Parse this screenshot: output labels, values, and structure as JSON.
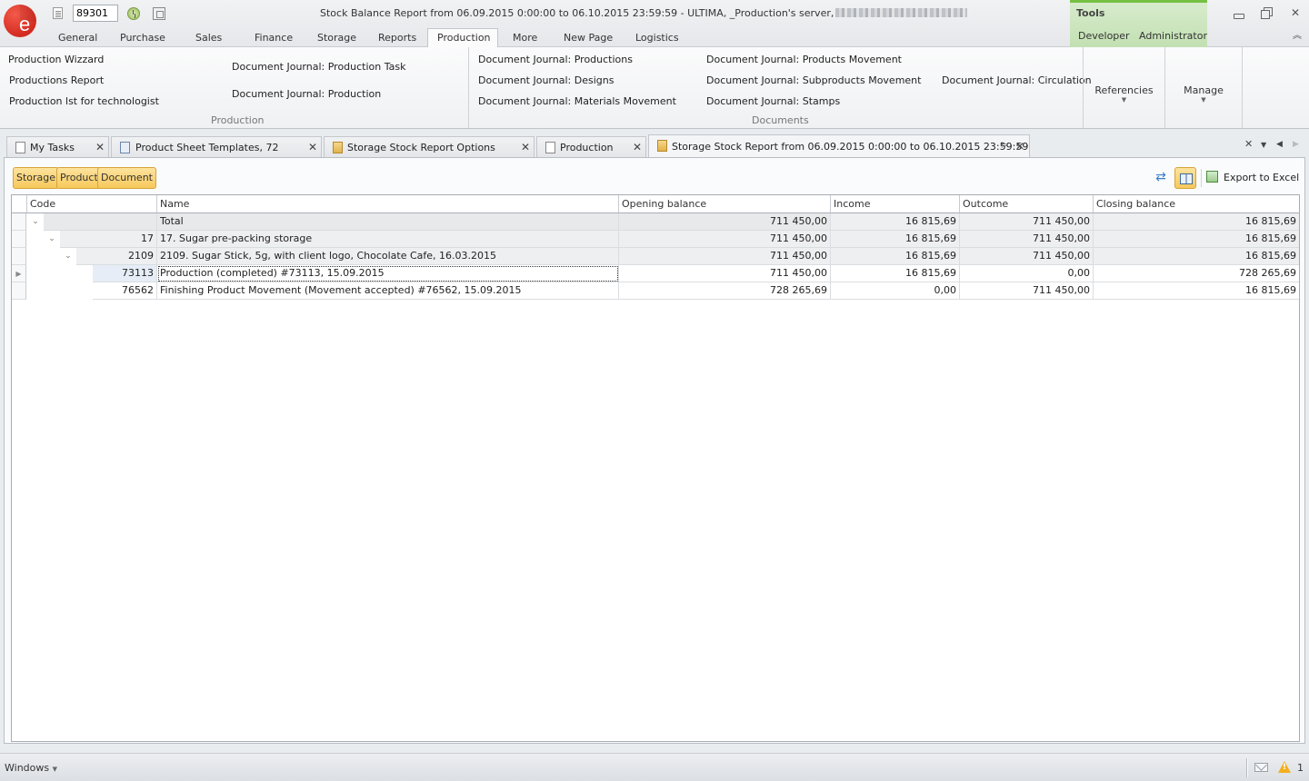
{
  "app": {
    "window_title": "Stock Balance Report from 06.09.2015 0:00:00 to 06.10.2015 23:59:59 - ULTIMA, _Production's server,",
    "document_number": "89301",
    "logo_letter": "e"
  },
  "ribbon_tabs": [
    "General",
    "Purchase",
    "Sales",
    "Finance",
    "Storage",
    "Reports",
    "Production",
    "More",
    "New Page",
    "Logistics"
  ],
  "active_ribbon_tab": "Production",
  "context_tabs": {
    "group_label": "Tools",
    "tabs": [
      "Developer",
      "Administrator"
    ],
    "accent_color": "#76c043"
  },
  "ribbon": {
    "production_group": {
      "label": "Production",
      "items": [
        "Production Wizzard",
        "Productions Report",
        "Production lst for technologist",
        "Document Journal: Production Task",
        "Document Journal: Production"
      ]
    },
    "documents_group": {
      "label": "Documents",
      "items": [
        "Document Journal: Productions",
        "Document Journal: Designs",
        "Document Journal: Materials Movement",
        "Document Journal: Products Movement",
        "Document Journal: Subproducts Movement",
        "Document Journal: Stamps",
        "Document Journal: Circulation"
      ]
    },
    "big_buttons": [
      "Referencies",
      "Manage"
    ]
  },
  "doc_tabs": [
    {
      "label": "My Tasks",
      "icon": "tasks-icon"
    },
    {
      "label": "Product Sheet Templates, 72",
      "icon": "template-edit-icon"
    },
    {
      "label": "Storage Stock Report Options",
      "icon": "report-options-icon"
    },
    {
      "label": "Production",
      "icon": "document-icon"
    },
    {
      "label": "Storage Stock Report from 06.09.2015 0:00:00 to 06.10.2015 23:59:59",
      "icon": "report-clipboard-icon",
      "active": true
    }
  ],
  "toolbar": {
    "group_buttons": [
      "Storage",
      "Product",
      "Document"
    ],
    "export_label": "Export to Excel",
    "accent_color": "#f7c95b"
  },
  "grid": {
    "columns": [
      "Code",
      "Name",
      "Opening balance",
      "Income",
      "Outcome",
      "Closing balance"
    ],
    "rows": [
      {
        "level": 0,
        "code": "",
        "name": "Total",
        "opening": "711 450,00",
        "income": "16 815,69",
        "outcome": "711 450,00",
        "closing": "16 815,69"
      },
      {
        "level": 1,
        "code": "17",
        "name": "17. Sugar pre-packing storage",
        "opening": "711 450,00",
        "income": "16 815,69",
        "outcome": "711 450,00",
        "closing": "16 815,69"
      },
      {
        "level": 2,
        "code": "2109",
        "name": "2109. Sugar Stick, 5g, with client logo, Chocolate Cafe, 16.03.2015",
        "opening": "711 450,00",
        "income": "16 815,69",
        "outcome": "711 450,00",
        "closing": "16 815,69"
      },
      {
        "level": 3,
        "code": "73113",
        "name": "Production (completed) #73113, 15.09.2015",
        "opening": "711 450,00",
        "income": "16 815,69",
        "outcome": "0,00",
        "closing": "728 265,69"
      },
      {
        "level": 3,
        "code": "76562",
        "name": "Finishing Product Movement (Movement accepted) #76562, 15.09.2015",
        "opening": "728 265,69",
        "income": "0,00",
        "outcome": "711 450,00",
        "closing": "16 815,69"
      }
    ]
  },
  "statusbar": {
    "windows_label": "Windows",
    "warning_count": "1"
  }
}
